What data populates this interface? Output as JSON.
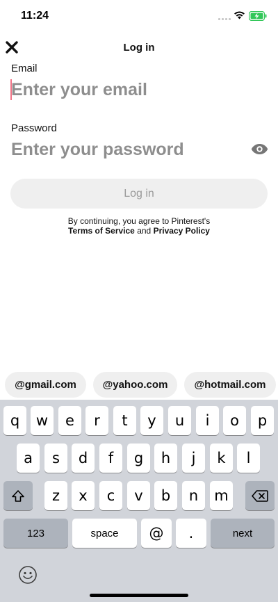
{
  "status_bar": {
    "time": "11:24",
    "battery_color": "#32c759"
  },
  "header": {
    "title": "Log in",
    "close_icon": "close-icon"
  },
  "form": {
    "email": {
      "label": "Email",
      "placeholder": "Enter your email",
      "value": ""
    },
    "password": {
      "label": "Password",
      "placeholder": "Enter your password",
      "value": ""
    },
    "login_button": "Log in",
    "terms_prefix": "By continuing, you agree to Pinterest's",
    "terms_of_service": "Terms of Service",
    "terms_and": "and",
    "privacy_policy": "Privacy Policy"
  },
  "email_suggestions": [
    "@gmail.com",
    "@yahoo.com",
    "@hotmail.com"
  ],
  "keyboard": {
    "row1": [
      "q",
      "w",
      "e",
      "r",
      "t",
      "y",
      "u",
      "i",
      "o",
      "p"
    ],
    "row2": [
      "a",
      "s",
      "d",
      "f",
      "g",
      "h",
      "j",
      "k",
      "l"
    ],
    "row3": [
      "z",
      "x",
      "c",
      "v",
      "b",
      "n",
      "m"
    ],
    "numbers_key": "123",
    "space_key": "space",
    "at_key": "@",
    "period_key": ".",
    "next_key": "next"
  },
  "colors": {
    "accent": "#e60023",
    "button_bg": "#efefef",
    "placeholder": "#8e8e8e",
    "keyboard_bg": "#d1d4da"
  }
}
